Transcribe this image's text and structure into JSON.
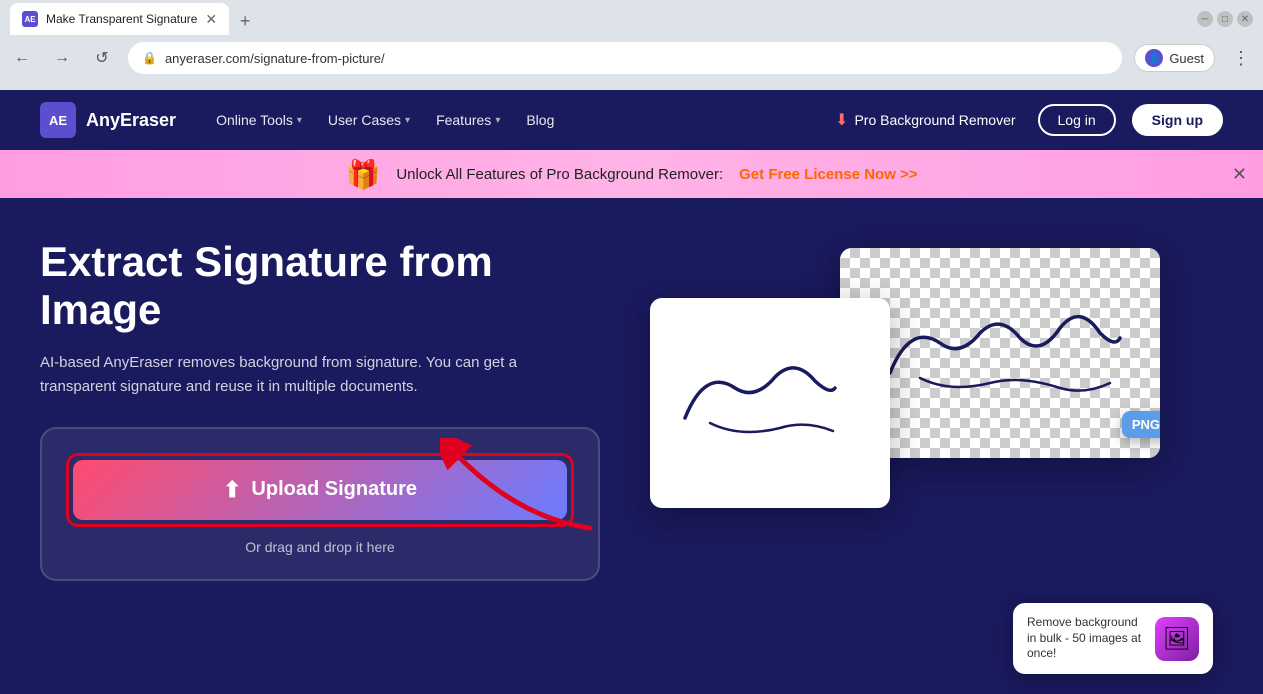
{
  "browser": {
    "tab_title": "Make Transparent Signature",
    "tab_favicon": "AE",
    "url": "anyeraser.com/signature-from-picture/",
    "profile_label": "Guest",
    "new_tab_label": "+"
  },
  "nav": {
    "back_icon": "←",
    "forward_icon": "→",
    "refresh_icon": "↺",
    "menu_icon": "⋮"
  },
  "site": {
    "logo_text": "AE",
    "brand": "AnyEraser",
    "nav_items": [
      {
        "label": "Online Tools",
        "has_chevron": true
      },
      {
        "label": "User Cases",
        "has_chevron": true
      },
      {
        "label": "Features",
        "has_chevron": true
      },
      {
        "label": "Blog",
        "has_chevron": false
      }
    ],
    "pro_label": "Pro Background Remover",
    "login_label": "Log in",
    "signup_label": "Sign up"
  },
  "banner": {
    "text": "Unlock All Features of Pro Background Remover:",
    "link": "Get Free License Now >>",
    "close_icon": "✕"
  },
  "hero": {
    "title": "Extract Signature from Image",
    "description": "AI-based AnyEraser removes background from signature. You can get a transparent signature and reuse it in multiple documents.",
    "upload_label": "Upload Signature",
    "drag_text": "Or drag and drop it here"
  },
  "popup": {
    "text": "Remove background in bulk - 50 images at once!"
  },
  "png_badge": "PNG"
}
